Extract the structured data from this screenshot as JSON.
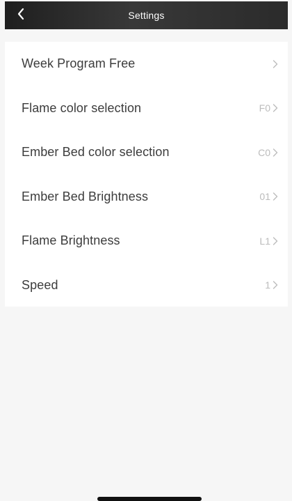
{
  "header": {
    "title": "Settings",
    "back_icon": "chevron-left-icon"
  },
  "settings": [
    {
      "label": "Week Program Free",
      "value": ""
    },
    {
      "label": "Flame color selection",
      "value": "F0"
    },
    {
      "label": "Ember Bed color selection",
      "value": "C0"
    },
    {
      "label": "Ember Bed Brightness",
      "value": "01"
    },
    {
      "label": "Flame Brightness",
      "value": "L1"
    },
    {
      "label": "Speed",
      "value": "1"
    }
  ],
  "colors": {
    "header_bg": "#2b2b2b",
    "page_bg": "#f6f6f6",
    "list_bg": "#ffffff",
    "label_text": "#3c3c3c",
    "value_text": "#bcbcbc"
  }
}
